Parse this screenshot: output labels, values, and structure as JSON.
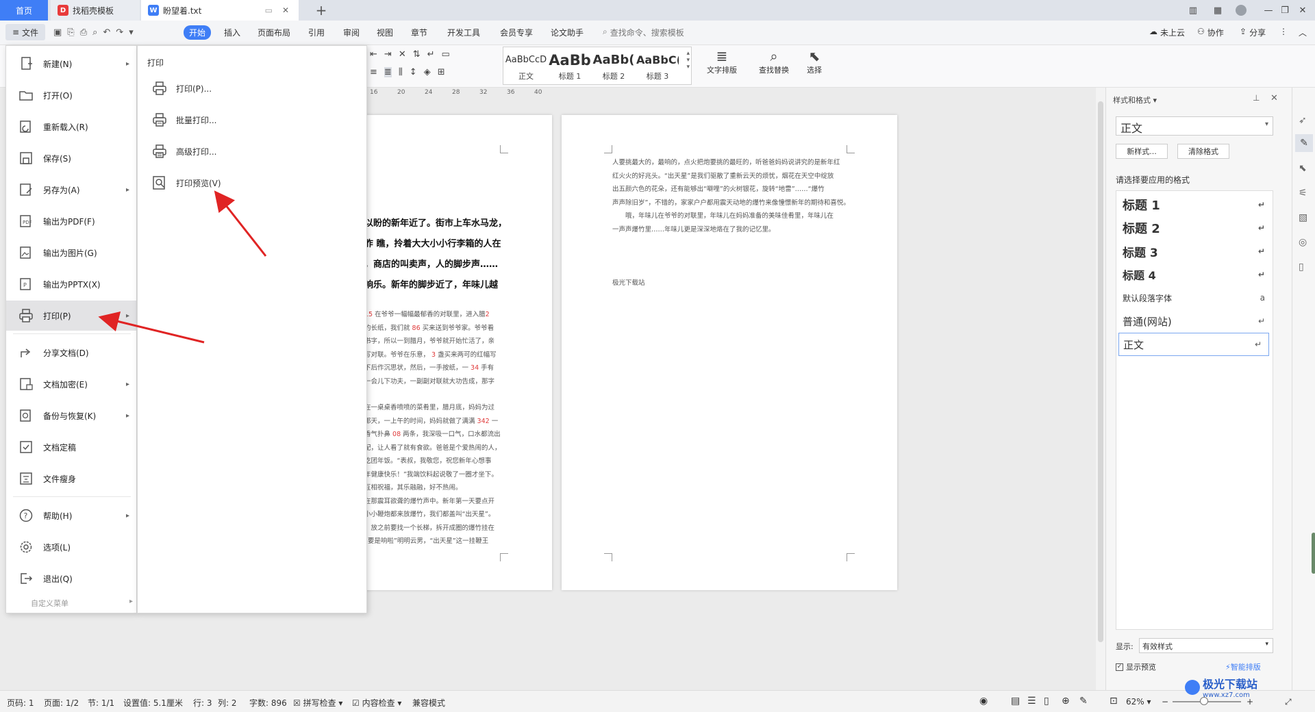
{
  "tabs": {
    "home": "首页",
    "template": "找稻壳模板",
    "document": "盼望着.txt",
    "add": "+"
  },
  "menubar": {
    "file": "文件",
    "items": [
      "开始",
      "插入",
      "页面布局",
      "引用",
      "审阅",
      "视图",
      "章节",
      "开发工具",
      "会员专享",
      "论文助手"
    ],
    "search": "查找命令、搜索模板",
    "cloud": "未上云",
    "collab": "协作",
    "share": "分享"
  },
  "ribbon": {
    "styles": [
      {
        "preview": "AaBbCcD",
        "label": "正文"
      },
      {
        "preview": "AaBb",
        "label": "标题 1"
      },
      {
        "preview": "AaBb(",
        "label": "标题 2"
      },
      {
        "preview": "AaBbC(",
        "label": "标题 3"
      }
    ],
    "text_layout": "文字排版",
    "find_replace": "查找替换",
    "select": "选择"
  },
  "ruler": [
    "16",
    "20",
    "24",
    "28",
    "32",
    "36",
    "40"
  ],
  "file_menu": {
    "items": [
      {
        "label": "新建(N)",
        "arrow": "▸"
      },
      {
        "label": "打开(O)"
      },
      {
        "label": "重新载入(R)"
      },
      {
        "label": "保存(S)"
      },
      {
        "label": "另存为(A)",
        "arrow": "▸"
      },
      {
        "label": "输出为PDF(F)"
      },
      {
        "label": "输出为图片(G)"
      },
      {
        "label": "输出为PPTX(X)"
      },
      {
        "label": "打印(P)",
        "arrow": "▸"
      },
      {
        "label": "分享文档(D)"
      },
      {
        "label": "文档加密(E)",
        "arrow": "▸"
      },
      {
        "label": "备份与恢复(K)",
        "arrow": "▸"
      },
      {
        "label": "文档定稿"
      },
      {
        "label": "文件瘦身"
      },
      {
        "label": "帮助(H)",
        "arrow": "▸"
      },
      {
        "label": "选项(L)"
      },
      {
        "label": "退出(Q)"
      }
    ],
    "custom": "自定义菜单",
    "custom_arrow": "▸"
  },
  "print_menu": {
    "title": "打印",
    "items": [
      "打印(P)...",
      "批量打印...",
      "高级打印...",
      "打印预览(V)"
    ]
  },
  "page_left": {
    "bold_lines": [
      "以盼的新年近了。街市上车水马龙，",
      "胙 瞧，拎着大大小小行李箱的人在",
      "，商店的叫卖声，人的脚步声……",
      "响乐。新年的脚步近了，年味儿越"
    ],
    "num_1": "15",
    "num_2": "2",
    "num_3": "86",
    "num_4": "3",
    "num_5": "34",
    "num_6": "342",
    "num_7": "08",
    "lines_a": [
      "在爷爷一幅幅最郁香的对联里，进入腊",
      "的长纸，我们就",
      "买来送到爷爷家。爷爷看",
      "书字，所以一到腊月，爷爷就开始忙活了，亲",
      "写对联。爷爷在乐意，",
      "盏买来两可的红幅写",
      "下后作沉思状，然后，一手按纸，一",
      "手有",
      "一会儿下功夫，一副副对联就大功告成，那字"
    ],
    "lines_b": [
      "在一桌桌香喷喷的菜肴里，腊月底，妈妈为过",
      "那天，一上午的时间，妈妈就做了满满",
      "一",
      "香气扑鼻",
      "两条，我深吸一口气，口水都流出",
      "配，让人看了就有食欲。爸爸是个爱热闹的人，",
      "吃团年饭。“表叔，我敬您，祝您新年心想事",
      "年健康快乐！”我端饮料起说敬了一圈才坐下。",
      "互相祝福，其乐融融，好不热闹。",
      "在那震耳欲聋的爆竹声中。新年第一天要点开",
      "小小鞭炮都来放爆竹，我们都盖叫“出天星”。",
      "，放之前要找一个长梯，拆开成圈的爆竹挂在",
      "“要是响啦”明明云男，“出天星”这一挂鞭王"
    ]
  },
  "page_right": {
    "lines": [
      "人要挑最大的，最响的，点火把炮要挑的最旺的，听爸爸妈妈说讲究的是新年红",
      "红火火的好兆头。“出天星”是我们驱散了重新云天的烦忧，烟花在天空中绽放",
      "出五颜六色的花朵，还有能够出“噼哩”的火树银花，旋转“地雷”……“爆竹",
      "声声除旧岁”，不错的，家家户户都用震天动地的爆竹来像憧憬新年的期待和喜悦。",
      "　　哦，年味儿在爷爷的对联里，年味儿在妈妈准备的美味佳肴里，年味儿在",
      "一声声爆竹里……年味儿更是深深地烙在了我的记忆里。"
    ],
    "footer": "极光下载站"
  },
  "right_panel": {
    "title": "样式和格式",
    "current": "正文",
    "new_style": "新样式...",
    "clear": "清除格式",
    "hint": "请选择要应用的格式",
    "styles": [
      "标题 1",
      "标题 2",
      "标题 3",
      "标题 4",
      "默认段落字体",
      "普通(网站)",
      "正文"
    ],
    "show_label": "显示:",
    "show_value": "有效样式",
    "preview_checkbox": "显示预览",
    "smart_layout": "智能排版"
  },
  "status": {
    "page": "页码: 1",
    "pages": "页面: 1/2",
    "section": "节: 1/1",
    "setting": "设置值: 5.1厘米",
    "row": "行: 3",
    "col": "列: 2",
    "words": "字数: 896",
    "spell": "拼写检查",
    "content": "内容检查",
    "compat": "兼容模式",
    "zoom": "62%"
  },
  "watermark": {
    "cn": "极光下载站",
    "en": "www.xz7.com"
  },
  "colors": {
    "accent": "#3f7ef6",
    "arrow": "#e02424",
    "wps_red": "#e83b3b"
  }
}
